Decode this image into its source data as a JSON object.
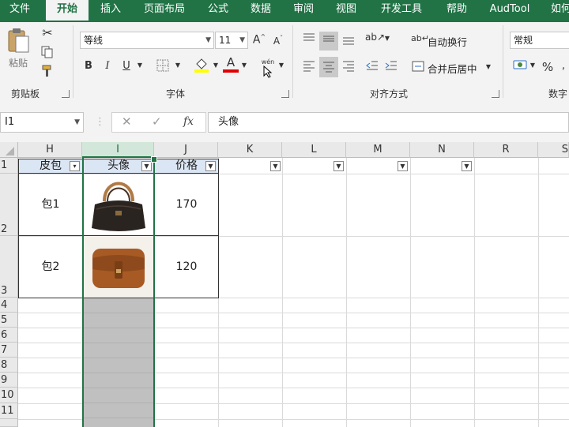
{
  "menu": {
    "items": [
      "文件",
      "开始",
      "插入",
      "页面布局",
      "公式",
      "数据",
      "审阅",
      "视图",
      "开发工具",
      "帮助",
      "AudTool",
      "如何"
    ],
    "active": "开始"
  },
  "ribbon": {
    "clipboard": {
      "paste": "粘贴",
      "label": "剪贴板"
    },
    "font": {
      "name": "等线",
      "size": "11",
      "bold": "B",
      "italic": "I",
      "underline": "U",
      "label": "字体",
      "phonetic": "wén"
    },
    "alignment": {
      "wrap": "自动换行",
      "merge": "合并后居中",
      "label": "对齐方式"
    },
    "number": {
      "format": "常规",
      "percent": "%",
      "label": "数字"
    }
  },
  "formula_bar": {
    "name_box": "I1",
    "cancel": "✕",
    "enter": "✓",
    "fx": "fx",
    "content": "头像"
  },
  "sheet": {
    "columns": [
      "H",
      "I",
      "J",
      "K",
      "L",
      "M",
      "N",
      "R",
      "S"
    ],
    "selected_column": "I",
    "rows": [
      "1",
      "2",
      "3",
      "4",
      "5",
      "6",
      "7",
      "8",
      "9",
      "10",
      "11"
    ],
    "headers": {
      "H": "皮包",
      "I": "头像",
      "J": "价格"
    },
    "data": [
      {
        "name": "包1",
        "price": "170",
        "image": "black-handbag"
      },
      {
        "name": "包2",
        "price": "120",
        "image": "brown-satchel"
      }
    ]
  },
  "colors": {
    "excel_green": "#217346",
    "header_fill": "#dbe6f4",
    "selection_gray": "#c0c0c0"
  }
}
